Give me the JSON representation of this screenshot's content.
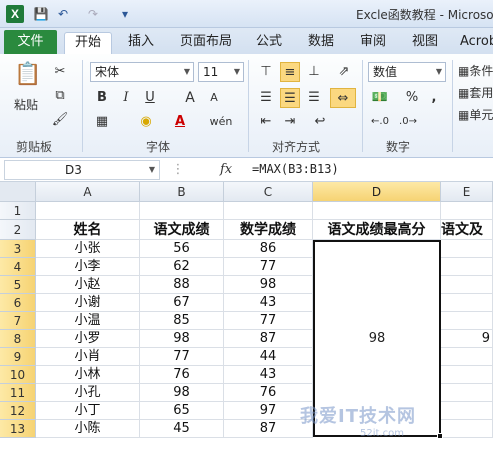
{
  "window": {
    "title": "Excle函数教程 - Microso",
    "app_icon": "X"
  },
  "quick_access": [
    "save-icon",
    "undo-icon",
    "redo-icon",
    "customize-icon"
  ],
  "ribbon_tabs": {
    "file": "文件",
    "items": [
      "开始",
      "插入",
      "页面布局",
      "公式",
      "数据",
      "审阅",
      "视图",
      "Acrob"
    ]
  },
  "ribbon": {
    "clipboard": {
      "paste": "粘贴",
      "label": "剪贴板"
    },
    "font": {
      "name": "宋体",
      "size": "11",
      "label": "字体",
      "bold": "B",
      "italic": "I",
      "underline": "U",
      "grow": "A",
      "shrink": "A",
      "color_a": "A",
      "wen": "wén"
    },
    "alignment": {
      "label": "对齐方式"
    },
    "number": {
      "format": "数值",
      "label": "数字",
      "percent": "%",
      "comma": ","
    },
    "styles": {
      "items": [
        "条件",
        "套用",
        "单元"
      ]
    }
  },
  "formula_bar": {
    "name_box": "D3",
    "fx": "fx",
    "formula": "=MAX(B3:B13)"
  },
  "sheet": {
    "columns": [
      "A",
      "B",
      "C",
      "D",
      "E"
    ],
    "rows": [
      "1",
      "2",
      "3",
      "4",
      "5",
      "6",
      "7",
      "8",
      "9",
      "10",
      "11",
      "12",
      "13"
    ],
    "headers": [
      "姓名",
      "语文成绩",
      "数学成绩",
      "语文成绩最高分",
      "语文及"
    ],
    "data": [
      [
        "小张",
        "56",
        "86"
      ],
      [
        "小李",
        "62",
        "77"
      ],
      [
        "小赵",
        "88",
        "98"
      ],
      [
        "小谢",
        "67",
        "43"
      ],
      [
        "小温",
        "85",
        "77"
      ],
      [
        "小罗",
        "98",
        "87"
      ],
      [
        "小肖",
        "77",
        "44"
      ],
      [
        "小林",
        "76",
        "43"
      ],
      [
        "小孔",
        "98",
        "76"
      ],
      [
        "小丁",
        "65",
        "97"
      ],
      [
        "小陈",
        "45",
        "87"
      ]
    ],
    "merged_value": "98",
    "e_partial": "9"
  },
  "watermark": {
    "text": "我爱IT技术网",
    "sub": "52it.com"
  },
  "colors": {
    "file_tab": "#2a8a3e",
    "selected_header": "#f6d373",
    "ribbon_bg": "#e8eff8"
  }
}
